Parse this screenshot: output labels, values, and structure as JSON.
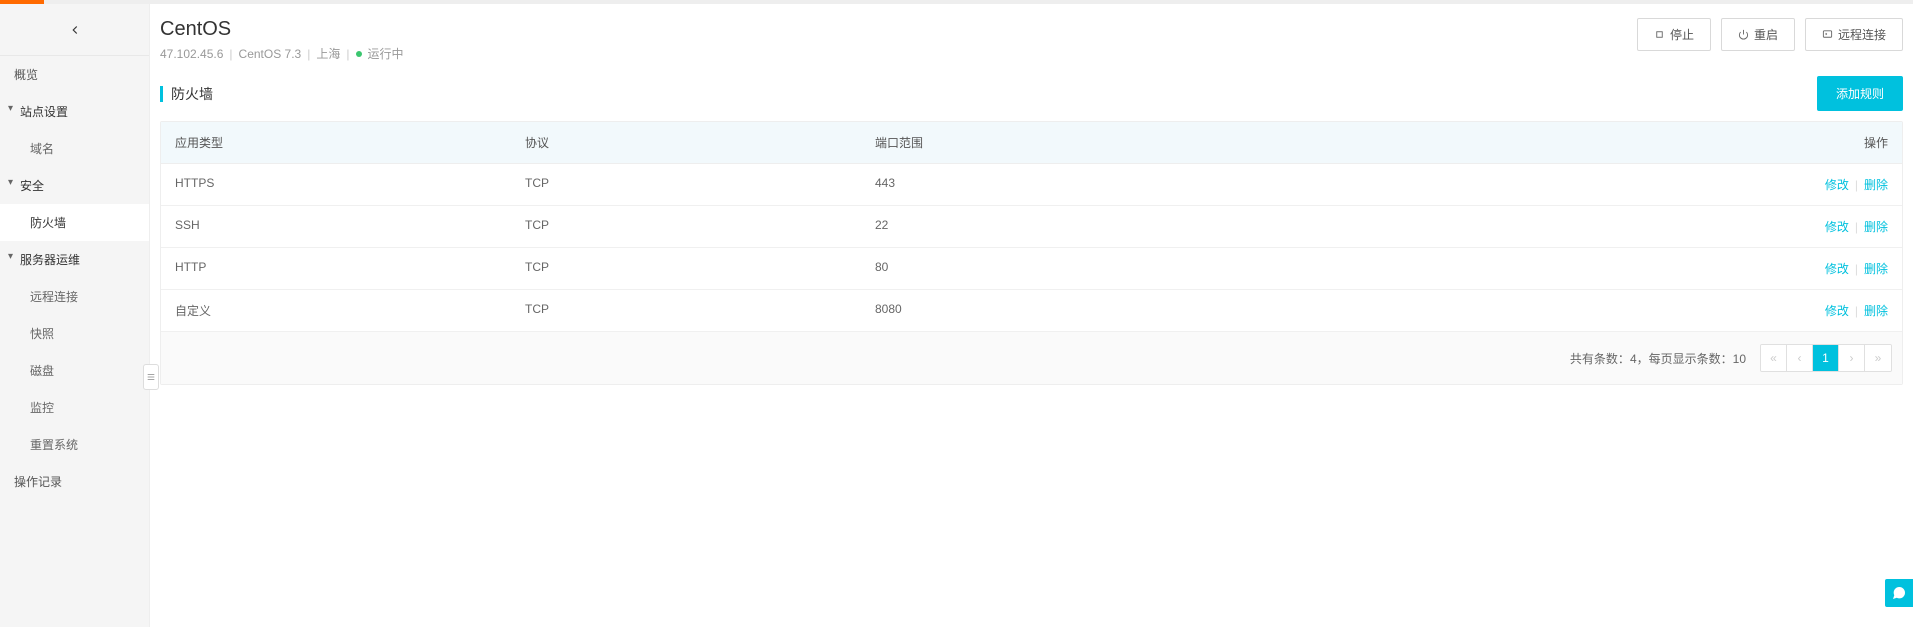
{
  "header": {
    "title": "CentOS",
    "ip": "47.102.45.6",
    "os": "CentOS 7.3",
    "region": "上海",
    "status_text": "运行中",
    "status_color": "#3bc66f",
    "actions": {
      "stop": "停止",
      "restart": "重启",
      "remote": "远程连接"
    }
  },
  "sidebar": {
    "overview": "概览",
    "site_settings": "站点设置",
    "domain": "域名",
    "security": "安全",
    "firewall": "防火墙",
    "ops": "服务器运维",
    "remote": "远程连接",
    "snapshot": "快照",
    "disk": "磁盘",
    "monitor": "监控",
    "reset_system": "重置系统",
    "oplog": "操作记录"
  },
  "section": {
    "title": "防火墙",
    "add_rule": "添加规则"
  },
  "table": {
    "headers": {
      "app_type": "应用类型",
      "protocol": "协议",
      "port_range": "端口范围",
      "action": "操作"
    },
    "action_labels": {
      "edit": "修改",
      "delete": "删除"
    },
    "rows": [
      {
        "app_type": "HTTPS",
        "protocol": "TCP",
        "port": "443"
      },
      {
        "app_type": "SSH",
        "protocol": "TCP",
        "port": "22"
      },
      {
        "app_type": "HTTP",
        "protocol": "TCP",
        "port": "80"
      },
      {
        "app_type": "自定义",
        "protocol": "TCP",
        "port": "8080"
      }
    ]
  },
  "pagination": {
    "summary_prefix": "共有条数：",
    "total": "4",
    "per_page_prefix": "，每页显示条数：",
    "per_page": "10",
    "current": "1"
  }
}
